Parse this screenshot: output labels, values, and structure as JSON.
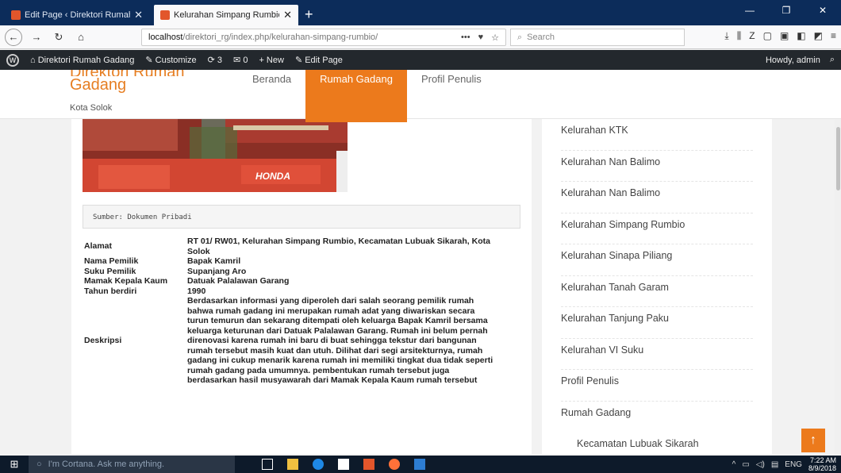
{
  "browser": {
    "tabs": [
      {
        "title": "Edit Page ‹ Direktori Rumah Ga"
      },
      {
        "title": "Kelurahan Simpang Rumbio – "
      }
    ],
    "url_host": "localhost",
    "url_path": "/direktori_rg/index.php/kelurahan-simpang-rumbio/",
    "search_placeholder": "Search"
  },
  "adminbar": {
    "site": "Direktori Rumah Gadang",
    "customize": "Customize",
    "updates": "3",
    "comments": "0",
    "new": "New",
    "edit": "Edit Page",
    "howdy": "Howdy, admin"
  },
  "site": {
    "name_line1": "Direktori Rumah",
    "name_line2": "Gadang",
    "tagline": "Kota Solok",
    "nav": [
      "Beranda",
      "Rumah Gadang",
      "Profil Penulis"
    ]
  },
  "content": {
    "caption": "Sumber: Dokumen Pribadi",
    "rows": [
      {
        "label": "Alamat",
        "value": "RT 01/ RW01, Kelurahan Simpang Rumbio, Kecamatan Lubuak Sikarah, Kota Solok"
      },
      {
        "label": "Nama Pemilik",
        "value": "Bapak Kamril"
      },
      {
        "label": "Suku Pemilik",
        "value": "Supanjang Aro"
      },
      {
        "label": "Mamak Kepala Kaum",
        "value": "Datuak Palalawan Garang"
      },
      {
        "label": "Tahun berdiri",
        "value": "1990"
      },
      {
        "label": "Deskripsi",
        "value": "Berdasarkan informasi yang diperoleh dari salah seorang pemilik rumah bahwa rumah gadang ini merupakan rumah adat yang diwariskan secara turun temurun dan sekarang ditempati oleh keluarga Bapak Kamril bersama keluarga keturunan dari Datuak Palalawan Garang. Rumah ini belum pernah direnovasi karena rumah ini baru di buat sehingga tekstur dari bangunan rumah tersebut masih kuat dan utuh. Dilihat dari segi arsitekturnya, rumah gadang ini cukup menarik karena rumah ini memiliki tingkat dua tidak seperti rumah gadang pada umumnya. pembentukan rumah tersebut juga berdasarkan hasil musyawarah dari Mamak Kepala Kaum rumah tersebut"
      }
    ],
    "photo_sign": "HONDA"
  },
  "sidebar": {
    "items": [
      "Kelurahan KTK",
      "Kelurahan Nan Balimo",
      "Kelurahan Nan Balimo",
      "Kelurahan Simpang Rumbio",
      "Kelurahan Sinapa Piliang",
      "Kelurahan Tanah Garam",
      "Kelurahan Tanjung Paku",
      "Kelurahan VI Suku",
      "Profil Penulis",
      "Rumah Gadang"
    ],
    "sub_item": "Kecamatan Lubuak Sikarah"
  },
  "taskbar": {
    "cortana": "I'm Cortana. Ask me anything.",
    "lang": "ENG",
    "time": "7:22 AM",
    "date": "8/9/2018"
  },
  "colors": {
    "accent": "#ec7a1c",
    "brand": "#e67e22"
  }
}
